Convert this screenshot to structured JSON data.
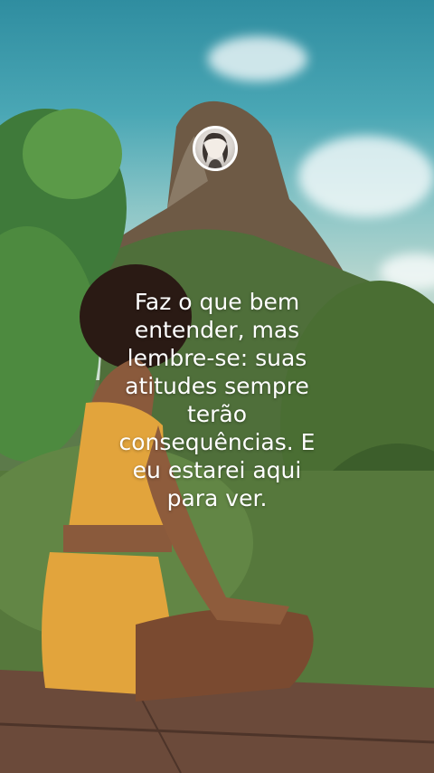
{
  "profile": {
    "avatar_icon": "profile-avatar-icon"
  },
  "quote": {
    "lines": [
      "Faz o que bem",
      "entender, mas",
      "lembre-se: suas",
      "atitudes sempre",
      "terão",
      "consequências. E",
      "eu estarei aqui",
      "para ver."
    ]
  },
  "colors": {
    "text": "#ffffff",
    "avatar_border": "#ffffff"
  }
}
